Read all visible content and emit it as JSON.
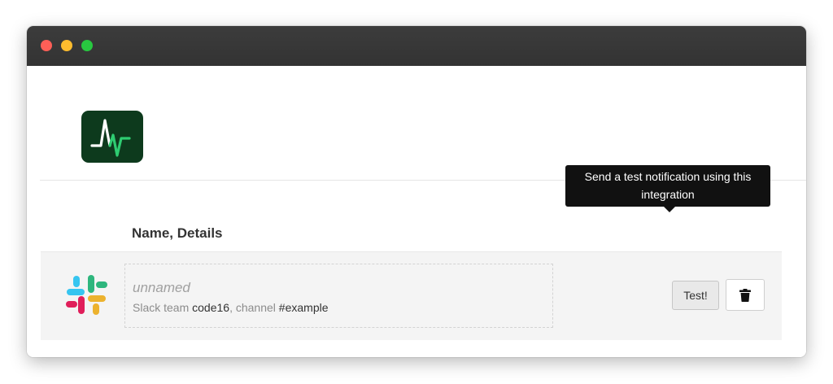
{
  "window": {
    "controls": [
      "close-button",
      "minimize-button",
      "maximize-button"
    ],
    "colors": {
      "close": "#fe5f57",
      "minimize": "#febc2e",
      "maximize": "#28c840",
      "titlebar": "#353535"
    }
  },
  "brand": {
    "logo_icon": "pulse-logo-icon",
    "logo_color": "#0d3a1d",
    "accent": "#22c55e"
  },
  "table": {
    "header": "Name, Details"
  },
  "integration": {
    "icon": "slack-icon",
    "name": "unnamed",
    "team_label": "Slack team",
    "team_value": "code16",
    "channel_label": "channel",
    "channel_value": "#example",
    "test_button_label": "Test!",
    "delete_icon": "trash-icon"
  },
  "tooltip": {
    "text": "Send a test notification using this integration"
  }
}
